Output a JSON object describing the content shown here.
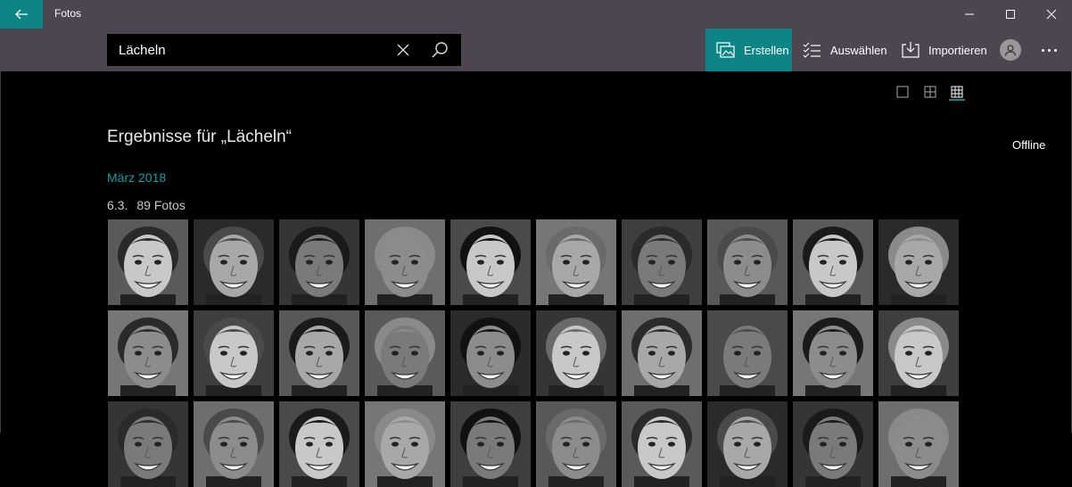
{
  "app": {
    "title": "Fotos"
  },
  "icons": {
    "back": "back-arrow-icon",
    "minimize": "minimize-icon",
    "maximize": "maximize-icon",
    "close": "close-icon",
    "clear": "clear-x-icon",
    "search": "search-icon",
    "create": "create-slideshow-icon",
    "select": "select-list-icon",
    "import": "import-icon",
    "account": "person-icon",
    "more": "more-dots-icon"
  },
  "search": {
    "query": "Lächeln"
  },
  "toolbar": {
    "create_label": "Erstellen",
    "select_label": "Auswählen",
    "import_label": "Importieren"
  },
  "view": {
    "options": [
      "single-view-icon",
      "medium-grid-icon",
      "small-grid-icon"
    ],
    "selected": "small-grid-icon"
  },
  "results": {
    "title": "Ergebnisse für „Lächeln“",
    "status": "Offline",
    "month": "März 2018",
    "date": "6.3.",
    "count": "89 Fotos"
  },
  "colors": {
    "accent": "#0d8485",
    "titlebar": "#4d4550",
    "month_link": "#1a9aa3",
    "background": "#000000"
  },
  "grid": {
    "columns": 10,
    "visible_rows": 3
  }
}
